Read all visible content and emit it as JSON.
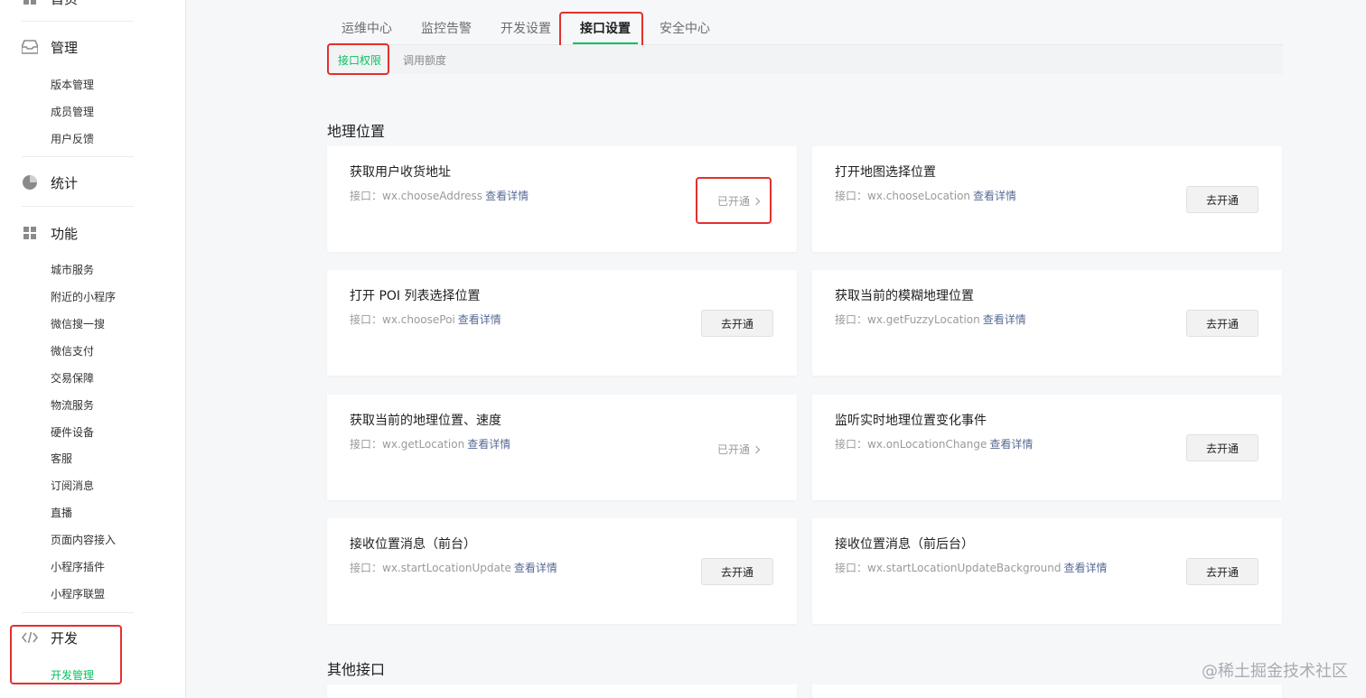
{
  "sidebar": {
    "top_cutoff_label": "首页",
    "groups": [
      {
        "label": "管理",
        "icon": "inbox-icon",
        "items": [
          "版本管理",
          "成员管理",
          "用户反馈"
        ]
      },
      {
        "label": "统计",
        "icon": "pie-chart-icon",
        "items": []
      },
      {
        "label": "功能",
        "icon": "grid-icon",
        "items": [
          "城市服务",
          "附近的小程序",
          "微信搜一搜",
          "微信支付",
          "交易保障",
          "物流服务",
          "硬件设备",
          "客服",
          "订阅消息",
          "直播",
          "页面内容接入",
          "小程序插件",
          "小程序联盟"
        ]
      },
      {
        "label": "开发",
        "icon": "code-icon",
        "items": [
          "开发管理"
        ],
        "active_item": "开发管理"
      }
    ]
  },
  "tabs": [
    {
      "label": "运维中心",
      "active": false
    },
    {
      "label": "监控告警",
      "active": false
    },
    {
      "label": "开发设置",
      "active": false
    },
    {
      "label": "接口设置",
      "active": true
    },
    {
      "label": "安全中心",
      "active": false
    }
  ],
  "subtabs": [
    {
      "label": "接口权限",
      "active": true
    },
    {
      "label": "调用额度",
      "active": false
    }
  ],
  "sections": {
    "geo_title": "地理位置",
    "other_title": "其他接口"
  },
  "common": {
    "api_prefix": "接口：",
    "detail_link": "查看详情",
    "enabled_label": "已开通",
    "enable_button": "去开通"
  },
  "cards": [
    {
      "title": "获取用户收货地址",
      "api": "wx.chooseAddress",
      "status": "enabled"
    },
    {
      "title": "打开地图选择位置",
      "api": "wx.chooseLocation",
      "status": "disabled"
    },
    {
      "title": "打开 POI 列表选择位置",
      "api": "wx.choosePoi",
      "status": "disabled"
    },
    {
      "title": "获取当前的模糊地理位置",
      "api": "wx.getFuzzyLocation",
      "status": "disabled"
    },
    {
      "title": "获取当前的地理位置、速度",
      "api": "wx.getLocation",
      "status": "enabled"
    },
    {
      "title": "监听实时地理位置变化事件",
      "api": "wx.onLocationChange",
      "status": "disabled"
    },
    {
      "title": "接收位置消息（前台）",
      "api": "wx.startLocationUpdate",
      "status": "disabled"
    },
    {
      "title": "接收位置消息（前后台）",
      "api": "wx.startLocationUpdateBackground",
      "status": "disabled"
    }
  ],
  "watermark": "@稀土掘金技术社区",
  "colors": {
    "accent": "#07c160",
    "link": "#576b95",
    "highlight": "#e3302d"
  }
}
